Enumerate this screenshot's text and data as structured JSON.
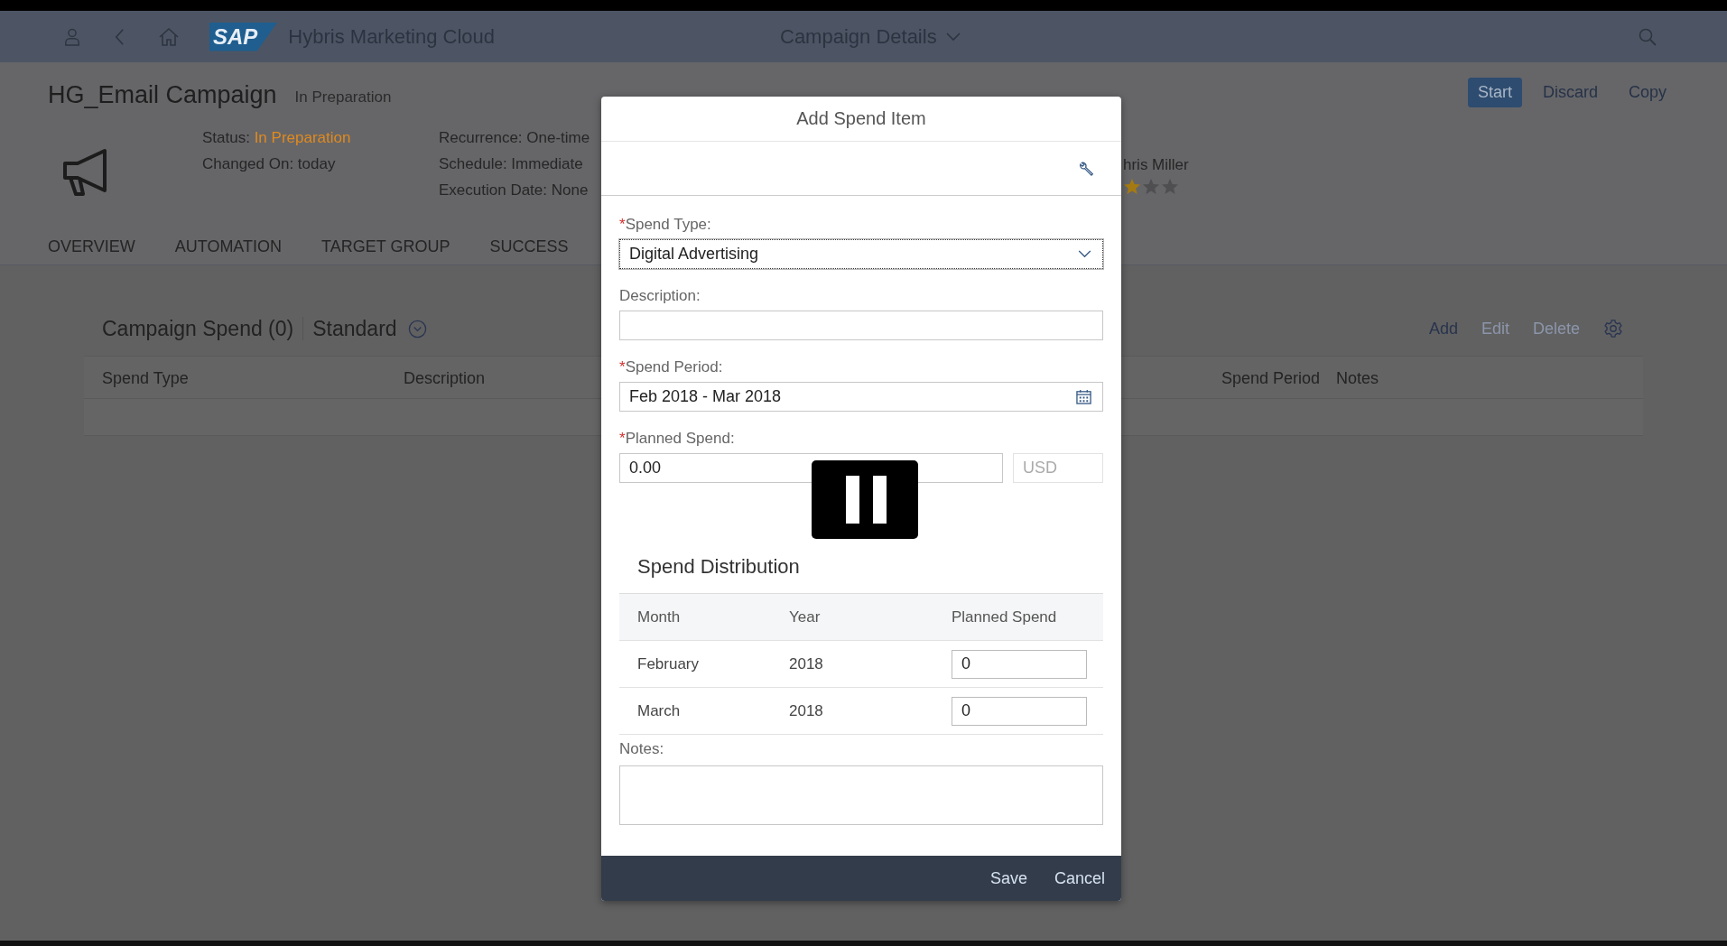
{
  "shell": {
    "logo": "SAP",
    "title": "Hybris Marketing Cloud",
    "page_menu": "Campaign Details"
  },
  "header": {
    "title": "HG_Email Campaign",
    "state": "In Preparation",
    "facts": [
      [
        {
          "label": "Status:",
          "value": "In Preparation",
          "kind": "status"
        },
        {
          "label": "Changed On:",
          "value": "today",
          "kind": "plain"
        }
      ],
      [
        {
          "label": "Recurrence:",
          "value": "One-time",
          "kind": "plain"
        },
        {
          "label": "Schedule:",
          "value": "Immediate",
          "kind": "plain"
        },
        {
          "label": "Execution Date:",
          "value": "None",
          "kind": "plain"
        }
      ]
    ],
    "owner": "hris Miller",
    "stars": 1,
    "actions": [
      {
        "label": "Start",
        "kind": "emphasized"
      },
      {
        "label": "Discard",
        "kind": "plain"
      },
      {
        "label": "Copy",
        "kind": "plain"
      }
    ]
  },
  "tabs": [
    {
      "label": "OVERVIEW"
    },
    {
      "label": "AUTOMATION"
    },
    {
      "label": "TARGET GROUP"
    },
    {
      "label": "SUCCESS"
    }
  ],
  "spend_table": {
    "title": "Campaign Spend (0)",
    "variant": "Standard",
    "actions": [
      {
        "label": "Add",
        "disabled": false
      },
      {
        "label": "Edit",
        "disabled": true
      },
      {
        "label": "Delete",
        "disabled": true
      }
    ],
    "columns": [
      {
        "label": "Spend Type"
      },
      {
        "label": "Description"
      },
      {
        "label": "Spend Period"
      },
      {
        "label": "Notes"
      }
    ]
  },
  "dialog": {
    "title": "Add Spend Item",
    "required_mark": "*",
    "spend_type": {
      "label": "Spend Type:",
      "required": true,
      "value": "Digital Advertising"
    },
    "description": {
      "label": "Description:",
      "required": false
    },
    "spend_period": {
      "label": "Spend Period:",
      "required": true,
      "value": "Feb 2018 - Mar 2018"
    },
    "planned_spend": {
      "label": "Planned Spend:",
      "required": true,
      "value": "0.00",
      "currency": "USD"
    },
    "distribution": {
      "title": "Spend Distribution",
      "columns": [
        "Month",
        "Year",
        "Planned Spend"
      ],
      "rows": [
        {
          "month": "February",
          "year": "2018",
          "amount": "0"
        },
        {
          "month": "March",
          "year": "2018",
          "amount": "0"
        }
      ]
    },
    "notes": {
      "label": "Notes:",
      "required": false
    },
    "buttons": [
      {
        "label": "Save"
      },
      {
        "label": "Cancel"
      }
    ]
  },
  "video_overlay": {
    "paused": true
  }
}
